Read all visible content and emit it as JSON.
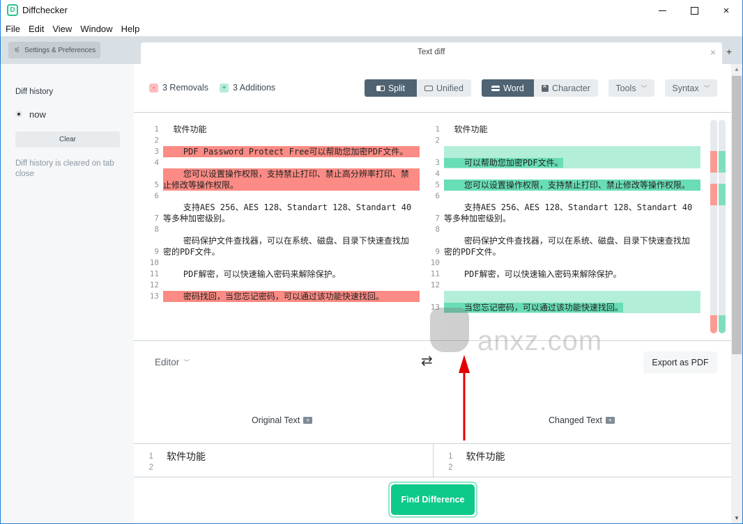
{
  "window": {
    "title": "Diffchecker",
    "logo_letter": "D",
    "controls": {
      "minimize": "minimize",
      "maximize": "maximize",
      "close": "×"
    }
  },
  "menu": [
    "File",
    "Edit",
    "View",
    "Window",
    "Help"
  ],
  "settings_button": "Settings & Preferences",
  "sidebar": {
    "history_title": "Diff history",
    "history_items": [
      {
        "label": "now",
        "selected": true
      }
    ],
    "clear_label": "Clear",
    "note": "Diff history is cleared on tab close"
  },
  "tab": {
    "label": "Text diff",
    "close": "×",
    "new_tab": "+"
  },
  "summary": {
    "removals_icon": "-",
    "removals": "3 Removals",
    "additions_icon": "+",
    "additions": "3 Additions"
  },
  "view_toggle": {
    "split": "Split",
    "unified": "Unified",
    "active": "split"
  },
  "granularity_toggle": {
    "word": "Word",
    "character": "Character",
    "active": "word"
  },
  "tools_label": "Tools",
  "syntax_label": "Syntax",
  "diff": {
    "left": [
      {
        "n": "1",
        "text": "  软件功能",
        "type": "normal"
      },
      {
        "n": "2",
        "text": "",
        "type": "normal"
      },
      {
        "n": "3",
        "text": "    PDF Password Protect Free可以帮助您加密PDF文件。",
        "type": "removed"
      },
      {
        "n": "4",
        "text": "",
        "type": "normal"
      },
      {
        "n": "5",
        "text": "    您可以设置操作权限，支持禁止打印、禁止高分辨率打印、禁止修改等操作权限。",
        "type": "removed"
      },
      {
        "n": "6",
        "text": "",
        "type": "normal"
      },
      {
        "n": "7",
        "text": "    支持AES 256、AES 128、Standart 128、Standart 40等多种加密级别。",
        "type": "normal"
      },
      {
        "n": "8",
        "text": "",
        "type": "normal"
      },
      {
        "n": "9",
        "text": "    密码保护文件查找器，可以在系统、磁盘、目录下快速查找加密的PDF文件。",
        "type": "normal"
      },
      {
        "n": "10",
        "text": "",
        "type": "normal"
      },
      {
        "n": "11",
        "text": "    PDF解密，可以快速输入密码来解除保护。",
        "type": "normal"
      },
      {
        "n": "12",
        "text": "",
        "type": "normal"
      },
      {
        "n": "13",
        "text": "    密码找回，当您忘记密码，可以通过该功能快速找回。",
        "type": "removed"
      }
    ],
    "right": [
      {
        "n": "1",
        "text": "  软件功能",
        "type": "normal"
      },
      {
        "n": "2",
        "text": "",
        "type": "normal"
      },
      {
        "n": "3",
        "text": "    可以帮助您加密PDF文件。",
        "type": "added"
      },
      {
        "n": "4",
        "text": "",
        "type": "normal"
      },
      {
        "n": "5",
        "text": "    您可以设置操作权限，支持禁止打印、禁止修改等操作权限。",
        "type": "added-full"
      },
      {
        "n": "6",
        "text": "",
        "type": "normal"
      },
      {
        "n": "7",
        "text": "    支持AES 256、AES 128、Standart 128、Standart 40等多种加密级别。",
        "type": "normal"
      },
      {
        "n": "8",
        "text": "",
        "type": "normal"
      },
      {
        "n": "9",
        "text": "    密码保护文件查找器，可以在系统、磁盘、目录下快速查找加密的PDF文件。",
        "type": "normal"
      },
      {
        "n": "10",
        "text": "",
        "type": "normal"
      },
      {
        "n": "11",
        "text": "    PDF解密，可以快速输入密码来解除保护。",
        "type": "normal"
      },
      {
        "n": "12",
        "text": "",
        "type": "normal"
      },
      {
        "n": "13",
        "text": "    当您忘记密码，可以通过该功能快速找回。",
        "type": "added"
      }
    ]
  },
  "editor_dropdown": "Editor",
  "export_label": "Export as PDF",
  "original_label": "Original Text",
  "changed_label": "Changed Text",
  "original_editor": [
    {
      "n": "1",
      "text": "软件功能"
    },
    {
      "n": "2",
      "text": ""
    }
  ],
  "changed_editor": [
    {
      "n": "1",
      "text": "软件功能"
    },
    {
      "n": "2",
      "text": ""
    }
  ],
  "find_button": "Find Difference",
  "watermark": "anxz.com",
  "colors": {
    "removed": "#fb8b84",
    "added_line": "#b3eed9",
    "added_word": "#69ddb5",
    "primary": "#0dc98a",
    "toggle_active": "#4f6372"
  }
}
